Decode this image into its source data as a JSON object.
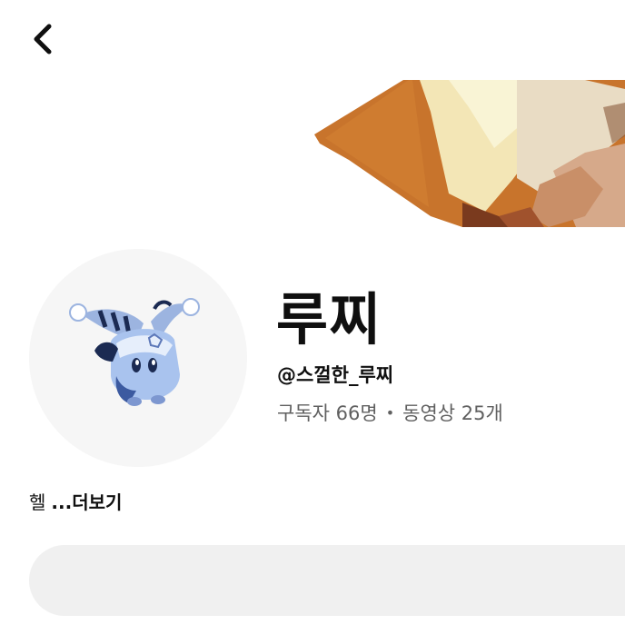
{
  "channel": {
    "name": "루찌",
    "handle": "@스껄한_루찌",
    "subscribers": "구독자 66명",
    "separator": "•",
    "videos": "동영상 25개"
  },
  "description": {
    "text": "헬",
    "more_label": "...더보기"
  },
  "icons": {
    "back": "chevron-left-icon"
  },
  "colors": {
    "text_primary": "#0f0f0f",
    "text_secondary": "#606060",
    "avatar_bg": "#f6f6f6",
    "action_bar_bg": "#f0f0f0",
    "banner_orange": "#c8742c",
    "banner_cream": "#f3e6b6"
  }
}
